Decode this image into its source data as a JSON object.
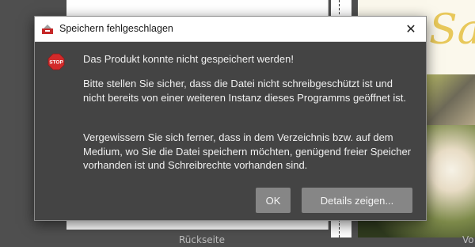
{
  "dialog": {
    "title": "Speichern fehlgeschlagen",
    "close_glyph": "✕",
    "icons": {
      "app": "app-icon",
      "stop": "stop-icon"
    },
    "stop_label": "STOP",
    "message_1": "Das Produkt konnte nicht gespeichert werden!",
    "message_2": "Bitte stellen Sie sicher, dass die Datei nicht schreibgeschützt ist und nicht bereits von einer weiteren Instanz dieses Programms geöffnet ist.",
    "message_3": "Vergewissern Sie sich ferner, dass in dem Verzeichnis bzw. auf dem Medium, wo Sie die Datei speichern möchten, genügend freier Speicher vorhanden ist und Schreibrechte vorhanden sind.",
    "buttons": {
      "ok": "OK",
      "details": "Details zeigen..."
    },
    "colors": {
      "body": "#444444",
      "button": "#868686",
      "stop_red": "#d22a2a"
    }
  },
  "workspace": {
    "label_back": "Rückseite",
    "label_right_partial": "Vo"
  }
}
